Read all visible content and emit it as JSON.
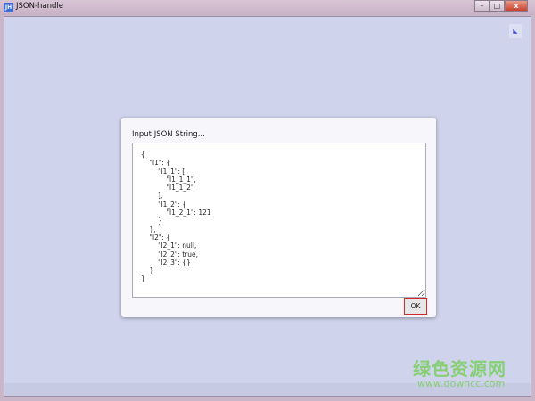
{
  "window": {
    "title": "JSON-handle",
    "icon_label": "JH",
    "minimize": "–",
    "maximize": "□",
    "close": "x"
  },
  "dialog": {
    "label": "Input JSON String...",
    "value": "{\n    \"l1\": {\n        \"l1_1\": [\n            \"l1_1_1\",\n            \"l1_1_2\"\n        ],\n        \"l1_2\": {\n            \"l1_2_1\": 121\n        }\n    },\n    \"l2\": {\n        \"l2_1\": null,\n        \"l2_2\": true,\n        \"l2_3\": {}\n    }\n}",
    "ok_label": "OK"
  },
  "watermark": {
    "name": "绿色资源网",
    "url": "www.downcc.com"
  }
}
